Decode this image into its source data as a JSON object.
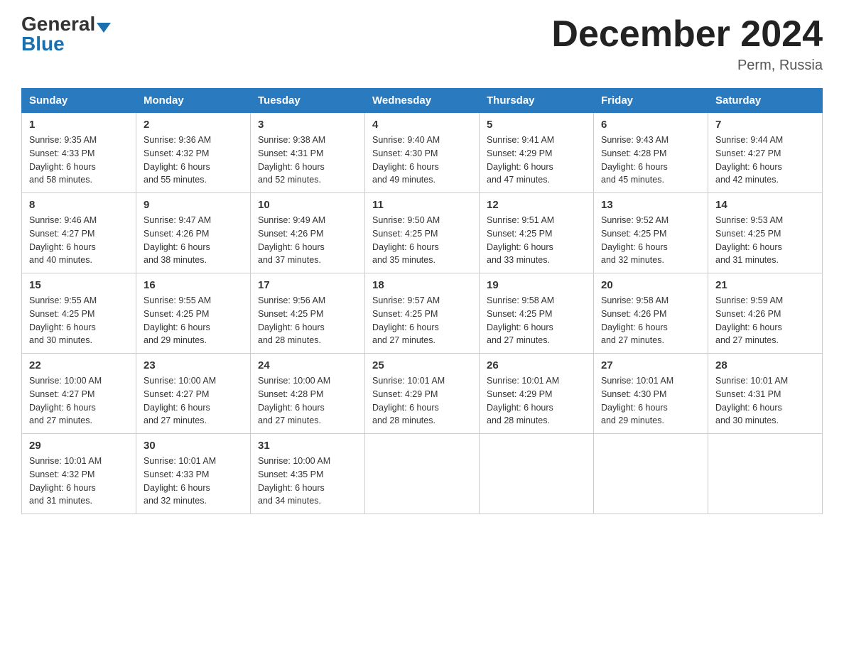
{
  "header": {
    "logo_general": "General",
    "logo_blue": "Blue",
    "month_title": "December 2024",
    "location": "Perm, Russia"
  },
  "weekdays": [
    "Sunday",
    "Monday",
    "Tuesday",
    "Wednesday",
    "Thursday",
    "Friday",
    "Saturday"
  ],
  "weeks": [
    [
      {
        "day": "1",
        "sunrise": "9:35 AM",
        "sunset": "4:33 PM",
        "daylight": "6 hours and 58 minutes."
      },
      {
        "day": "2",
        "sunrise": "9:36 AM",
        "sunset": "4:32 PM",
        "daylight": "6 hours and 55 minutes."
      },
      {
        "day": "3",
        "sunrise": "9:38 AM",
        "sunset": "4:31 PM",
        "daylight": "6 hours and 52 minutes."
      },
      {
        "day": "4",
        "sunrise": "9:40 AM",
        "sunset": "4:30 PM",
        "daylight": "6 hours and 49 minutes."
      },
      {
        "day": "5",
        "sunrise": "9:41 AM",
        "sunset": "4:29 PM",
        "daylight": "6 hours and 47 minutes."
      },
      {
        "day": "6",
        "sunrise": "9:43 AM",
        "sunset": "4:28 PM",
        "daylight": "6 hours and 45 minutes."
      },
      {
        "day": "7",
        "sunrise": "9:44 AM",
        "sunset": "4:27 PM",
        "daylight": "6 hours and 42 minutes."
      }
    ],
    [
      {
        "day": "8",
        "sunrise": "9:46 AM",
        "sunset": "4:27 PM",
        "daylight": "6 hours and 40 minutes."
      },
      {
        "day": "9",
        "sunrise": "9:47 AM",
        "sunset": "4:26 PM",
        "daylight": "6 hours and 38 minutes."
      },
      {
        "day": "10",
        "sunrise": "9:49 AM",
        "sunset": "4:26 PM",
        "daylight": "6 hours and 37 minutes."
      },
      {
        "day": "11",
        "sunrise": "9:50 AM",
        "sunset": "4:25 PM",
        "daylight": "6 hours and 35 minutes."
      },
      {
        "day": "12",
        "sunrise": "9:51 AM",
        "sunset": "4:25 PM",
        "daylight": "6 hours and 33 minutes."
      },
      {
        "day": "13",
        "sunrise": "9:52 AM",
        "sunset": "4:25 PM",
        "daylight": "6 hours and 32 minutes."
      },
      {
        "day": "14",
        "sunrise": "9:53 AM",
        "sunset": "4:25 PM",
        "daylight": "6 hours and 31 minutes."
      }
    ],
    [
      {
        "day": "15",
        "sunrise": "9:55 AM",
        "sunset": "4:25 PM",
        "daylight": "6 hours and 30 minutes."
      },
      {
        "day": "16",
        "sunrise": "9:55 AM",
        "sunset": "4:25 PM",
        "daylight": "6 hours and 29 minutes."
      },
      {
        "day": "17",
        "sunrise": "9:56 AM",
        "sunset": "4:25 PM",
        "daylight": "6 hours and 28 minutes."
      },
      {
        "day": "18",
        "sunrise": "9:57 AM",
        "sunset": "4:25 PM",
        "daylight": "6 hours and 27 minutes."
      },
      {
        "day": "19",
        "sunrise": "9:58 AM",
        "sunset": "4:25 PM",
        "daylight": "6 hours and 27 minutes."
      },
      {
        "day": "20",
        "sunrise": "9:58 AM",
        "sunset": "4:26 PM",
        "daylight": "6 hours and 27 minutes."
      },
      {
        "day": "21",
        "sunrise": "9:59 AM",
        "sunset": "4:26 PM",
        "daylight": "6 hours and 27 minutes."
      }
    ],
    [
      {
        "day": "22",
        "sunrise": "10:00 AM",
        "sunset": "4:27 PM",
        "daylight": "6 hours and 27 minutes."
      },
      {
        "day": "23",
        "sunrise": "10:00 AM",
        "sunset": "4:27 PM",
        "daylight": "6 hours and 27 minutes."
      },
      {
        "day": "24",
        "sunrise": "10:00 AM",
        "sunset": "4:28 PM",
        "daylight": "6 hours and 27 minutes."
      },
      {
        "day": "25",
        "sunrise": "10:01 AM",
        "sunset": "4:29 PM",
        "daylight": "6 hours and 28 minutes."
      },
      {
        "day": "26",
        "sunrise": "10:01 AM",
        "sunset": "4:29 PM",
        "daylight": "6 hours and 28 minutes."
      },
      {
        "day": "27",
        "sunrise": "10:01 AM",
        "sunset": "4:30 PM",
        "daylight": "6 hours and 29 minutes."
      },
      {
        "day": "28",
        "sunrise": "10:01 AM",
        "sunset": "4:31 PM",
        "daylight": "6 hours and 30 minutes."
      }
    ],
    [
      {
        "day": "29",
        "sunrise": "10:01 AM",
        "sunset": "4:32 PM",
        "daylight": "6 hours and 31 minutes."
      },
      {
        "day": "30",
        "sunrise": "10:01 AM",
        "sunset": "4:33 PM",
        "daylight": "6 hours and 32 minutes."
      },
      {
        "day": "31",
        "sunrise": "10:00 AM",
        "sunset": "4:35 PM",
        "daylight": "6 hours and 34 minutes."
      },
      null,
      null,
      null,
      null
    ]
  ],
  "labels": {
    "sunrise": "Sunrise: ",
    "sunset": "Sunset: ",
    "daylight": "Daylight: "
  }
}
